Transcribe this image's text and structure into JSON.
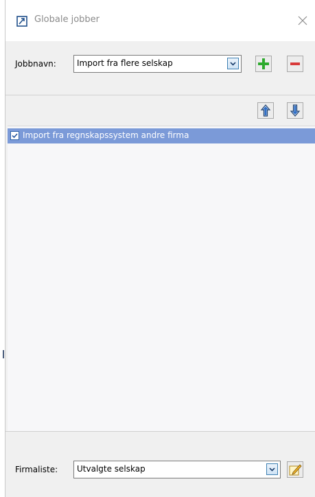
{
  "window": {
    "title": "Globale jobber",
    "close_icon": "close-icon",
    "app_icon": "job-window-icon"
  },
  "job": {
    "label": "Jobbnavn:",
    "selected": "Import fra flere selskap",
    "add_icon": "plus-icon",
    "remove_icon": "minus-icon"
  },
  "toolbar": {
    "move_up_icon": "arrow-up-icon",
    "move_down_icon": "arrow-down-icon"
  },
  "list": {
    "items": [
      {
        "label": "Import fra regnskapssystem andre firma",
        "checked": true,
        "selected": true
      }
    ]
  },
  "company_list": {
    "label": "Firmaliste:",
    "selected": "Utvalgte selskap",
    "edit_icon": "edit-pencil-icon"
  },
  "colors": {
    "selection": "#7b9ad8",
    "add_green": "#2eaa2e",
    "remove_red": "#d83a3a",
    "arrow_blue": "#2f6fc8"
  }
}
